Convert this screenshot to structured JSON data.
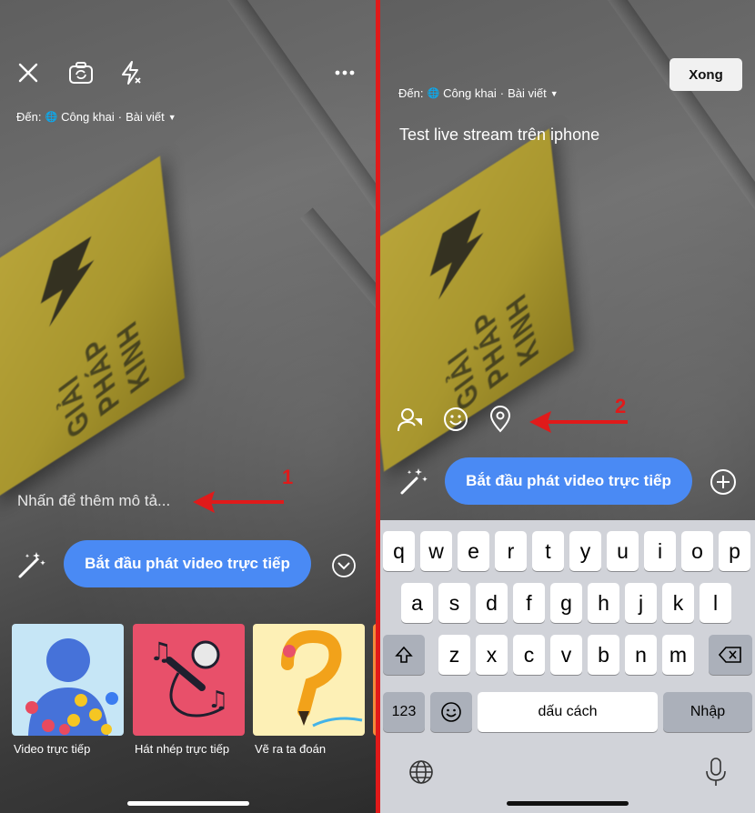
{
  "left": {
    "destination": {
      "prefix": "Đến:",
      "privacy": "Công khai",
      "separator": "·",
      "target": "Bài viết"
    },
    "description_placeholder": "Nhấn để thêm mô tả...",
    "go_live_label": "Bắt đầu phát video trực tiếp",
    "annotation_number": "1",
    "effects": [
      {
        "label": "Video trực tiếp"
      },
      {
        "label": "Hát nhép trực tiếp"
      },
      {
        "label": "Vẽ ra ta đoán"
      }
    ],
    "sign_text": "GIẢI PHÁP KINH"
  },
  "right": {
    "done_label": "Xong",
    "destination": {
      "prefix": "Đến:",
      "privacy": "Công khai",
      "separator": "·",
      "target": "Bài viết"
    },
    "description_text": "Test live stream trên iphone",
    "go_live_label": "Bắt đầu phát video trực tiếp",
    "annotation_number": "2",
    "keyboard": {
      "row1": [
        "q",
        "w",
        "e",
        "r",
        "t",
        "y",
        "u",
        "i",
        "o",
        "p"
      ],
      "row2": [
        "a",
        "s",
        "d",
        "f",
        "g",
        "h",
        "j",
        "k",
        "l"
      ],
      "row3": [
        "z",
        "x",
        "c",
        "v",
        "b",
        "n",
        "m"
      ],
      "numbers_label": "123",
      "space_label": "dấu cách",
      "return_label": "Nhập"
    }
  },
  "colors": {
    "accent": "#4a8af4",
    "annotation": "#e01a1a",
    "divider": "#e01a1a"
  }
}
